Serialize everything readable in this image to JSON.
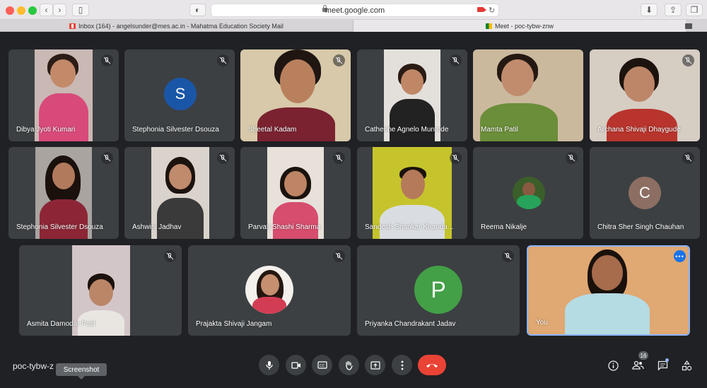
{
  "browser": {
    "url": "meet.google.com",
    "tabs": [
      {
        "label": "Inbox (164) - angelsunder@mes.ac.in - Mahatma Education Society Mail",
        "icon": "gmail-icon"
      },
      {
        "label": "Meet - poc-tybw-znw",
        "icon": "meet-icon"
      }
    ]
  },
  "participants": [
    {
      "name": "Dibya Jyoti Kumari"
    },
    {
      "name": "Stephonia Silvester Dsouza",
      "initial": "S",
      "color": "#1a56a8"
    },
    {
      "name": "Sheetal Kadam"
    },
    {
      "name": "Catherine Agnelo Muntode"
    },
    {
      "name": "Mamta Patil"
    },
    {
      "name": "Archana Shivaji Dhaygude"
    },
    {
      "name": "Stephonia Silvester Dsouza"
    },
    {
      "name": "Ashwini Jadhav"
    },
    {
      "name": "Parvati Shashi Sharma"
    },
    {
      "name": "Sandesh Shankar Khanda..."
    },
    {
      "name": "Reema Nikalje"
    },
    {
      "name": "Chitra Sher Singh Chauhan",
      "initial": "C",
      "color": "#8d6e63"
    },
    {
      "name": "Asmita Damodar Patil"
    },
    {
      "name": "Prajakta Shivaji Jangam"
    },
    {
      "name": "Priyanka Chandrakant Jadav",
      "initial": "P",
      "color": "#43a047"
    },
    {
      "name": "You"
    }
  ],
  "footer": {
    "meeting_code": "poc-tybw-z",
    "tooltip": "Screenshot",
    "people_count": "16"
  },
  "icons": {
    "mic": "microphone-icon",
    "camera": "camera-icon",
    "captions": "captions-icon",
    "hand": "raise-hand-icon",
    "present": "present-screen-icon",
    "more": "more-options-icon",
    "end": "end-call-icon",
    "info": "info-icon",
    "people": "people-icon",
    "chat": "chat-icon",
    "activities": "activities-icon"
  }
}
